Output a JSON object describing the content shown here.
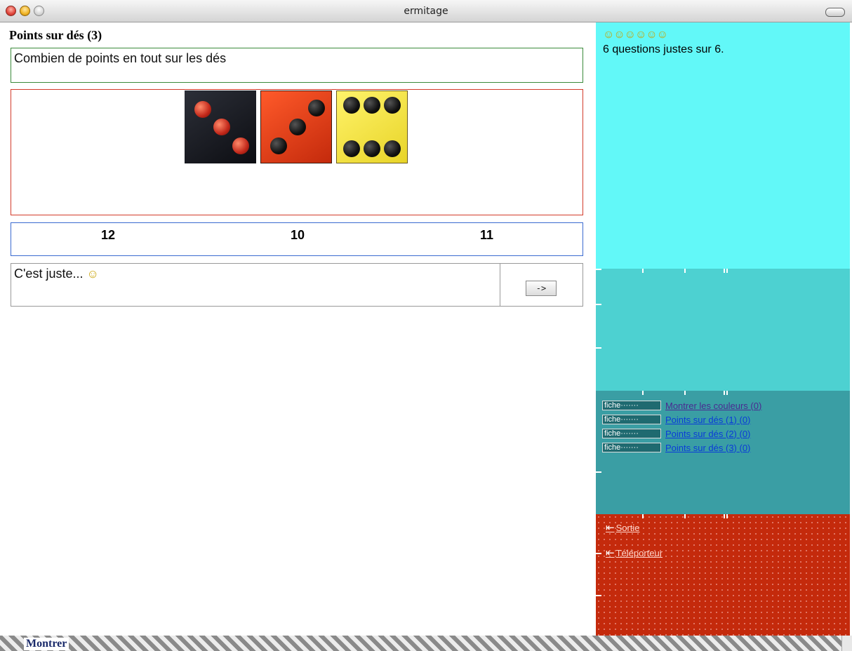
{
  "window": {
    "title": "ermitage"
  },
  "exercise": {
    "heading": "Points sur dés (3)",
    "question": "Combien de points en tout sur les dés",
    "answers": [
      "12",
      "10",
      "11"
    ],
    "feedback": "C'est juste...",
    "next_label": "->"
  },
  "sidebar": {
    "smileys": "☺☺☺☺☺☺",
    "score": "6 questions justes sur 6.",
    "tag_label": "fiche·······",
    "links": [
      {
        "label": "Montrer les couleurs (0)"
      },
      {
        "label": "Points sur dés (1) (0)"
      },
      {
        "label": "Points sur dés (2) (0)"
      },
      {
        "label": "Points sur dés (3) (0)"
      }
    ],
    "exits": [
      {
        "label": "Sortie"
      },
      {
        "label": "Téléporteur"
      }
    ]
  },
  "footer": {
    "label": "Montrer"
  }
}
